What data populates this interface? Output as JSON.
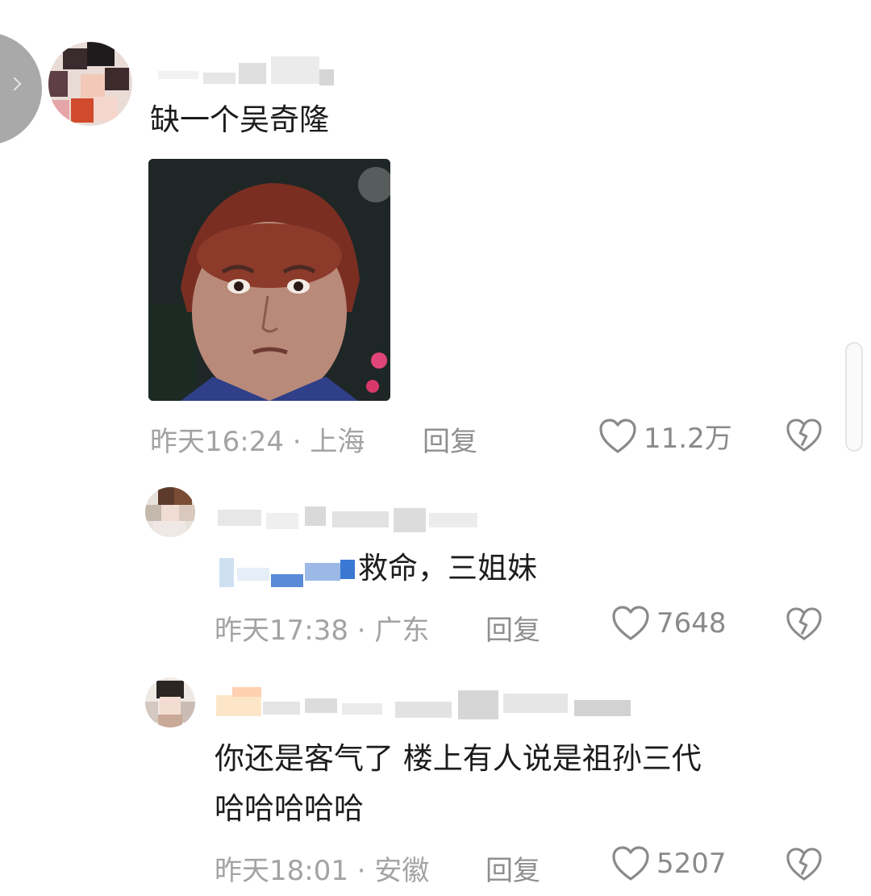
{
  "comments": [
    {
      "text": "缺一个吴奇隆",
      "time_location": "昨天16:24 · 上海",
      "reply_label": "回复",
      "likes": "11.2万"
    },
    {
      "text": "救命，三姐妹",
      "time_location": "昨天17:38 · 广东",
      "reply_label": "回复",
      "likes": "7648"
    },
    {
      "text_line1": "你还是客气了 楼上有人说是祖孙三代",
      "text_line2": "哈哈哈哈哈",
      "time_location": "昨天18:01 · 安徽",
      "reply_label": "回复",
      "likes": "5207"
    }
  ],
  "colors": {
    "meta_text": "#a3a3a3",
    "body_text": "#1c1c1c",
    "icon_gray": "#8a8a8a"
  }
}
